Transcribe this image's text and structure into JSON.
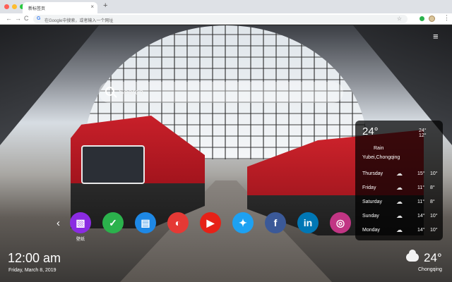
{
  "browser": {
    "tab_title": "新标签页",
    "tab_close": "×",
    "new_tab": "+",
    "nav_back": "←",
    "nav_forward": "→",
    "nav_reload": "C",
    "omnibox_icon": "G",
    "omnibox_text": "在Google中搜索，或者输入一个网址",
    "bookmark": "☆",
    "menu": "⋮"
  },
  "page": {
    "menu_icon": "≡",
    "search": {
      "placeholder": "Search"
    }
  },
  "weather": {
    "temp": "24°",
    "high": "24°",
    "low": "12°",
    "condition": "Rain",
    "city": "Yubei,Chongqing",
    "forecast": [
      {
        "day": "Thursday",
        "icon": "☁",
        "high": "15°",
        "low": "10°"
      },
      {
        "day": "Friday",
        "icon": "☁",
        "high": "11°",
        "low": "8°"
      },
      {
        "day": "Saturday",
        "icon": "☁",
        "high": "11°",
        "low": "8°"
      },
      {
        "day": "Sunday",
        "icon": "☁",
        "high": "14°",
        "low": "10°"
      },
      {
        "day": "Monday",
        "icon": "☁",
        "high": "14°",
        "low": "10°"
      }
    ]
  },
  "dock": {
    "prev_arrow": "‹",
    "first_label": "壁纸",
    "apps": [
      {
        "name": "wallpaper",
        "icon": "▧",
        "color": "#8a2be2"
      },
      {
        "name": "todo",
        "icon": "✓",
        "color": "#2bb24c"
      },
      {
        "name": "notes",
        "icon": "▤",
        "color": "#1e88e5"
      },
      {
        "name": "paint",
        "icon": "◐",
        "color": "#e53935"
      },
      {
        "name": "youtube",
        "icon": "▶",
        "color": "#e62117"
      },
      {
        "name": "twitter",
        "icon": "✦",
        "color": "#1da1f2"
      },
      {
        "name": "facebook",
        "icon": "f",
        "color": "#3b5998"
      },
      {
        "name": "linkedin",
        "icon": "in",
        "color": "#0077b5"
      },
      {
        "name": "instagram",
        "icon": "◎",
        "color": "#c13584"
      }
    ]
  },
  "clock": {
    "time": "12:00 am",
    "date": "Friday, March 8, 2019"
  },
  "bottom_weather": {
    "temp": "24°",
    "city": "Chongqing"
  }
}
